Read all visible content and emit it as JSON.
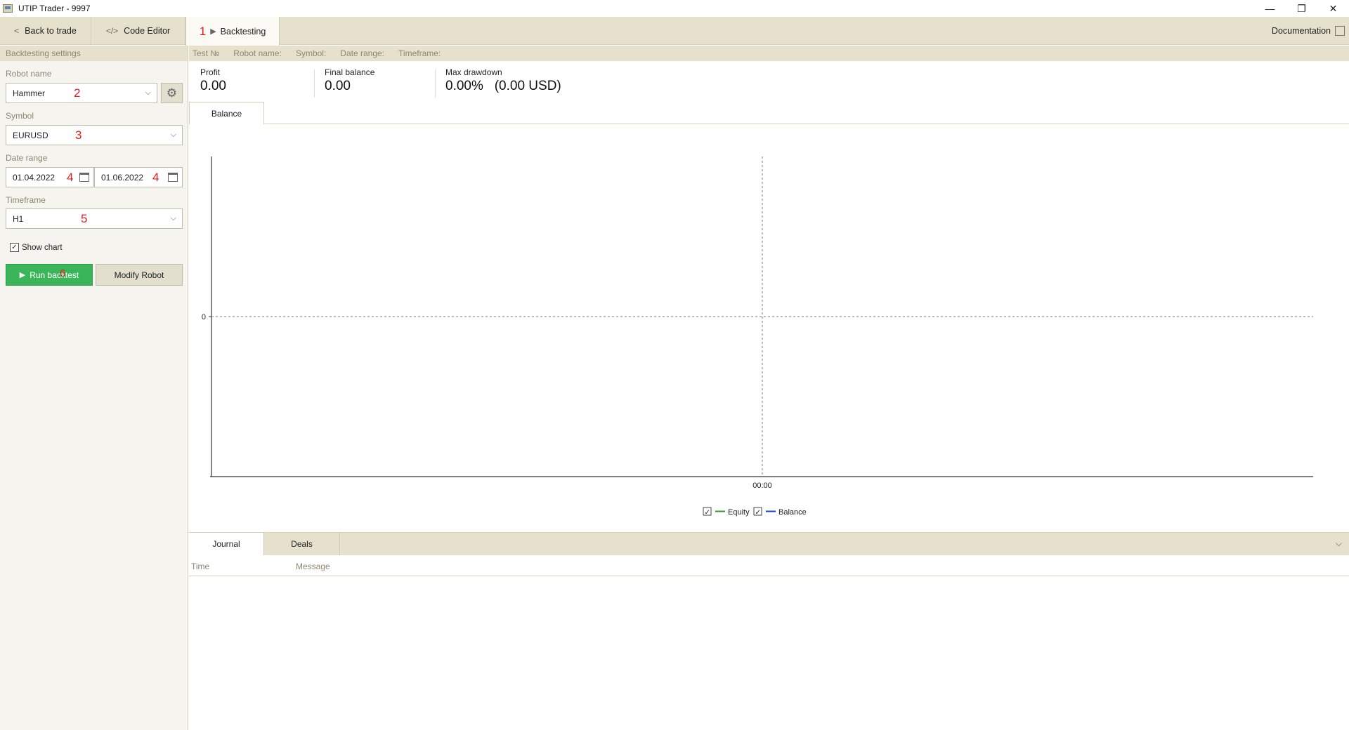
{
  "window": {
    "title": "UTIP Trader - 9997"
  },
  "tabs": {
    "back": "Back to trade",
    "code_editor": "Code Editor",
    "code_icon": "</>",
    "backtesting": "Backtesting",
    "backtesting_marker": "1",
    "documentation": "Documentation"
  },
  "settings": {
    "header": "Backtesting settings",
    "robot_label": "Robot name",
    "robot_value": "Hammer",
    "robot_marker": "2",
    "symbol_label": "Symbol",
    "symbol_value": "EURUSD",
    "symbol_marker": "3",
    "date_label": "Date range",
    "date_from": "01.04.2022",
    "date_to": "01.06.2022",
    "date_marker": "4",
    "timeframe_label": "Timeframe",
    "timeframe_value": "H1",
    "timeframe_marker": "5",
    "show_chart_label": "Show chart",
    "show_chart_checked": true,
    "run_label": "Run backtest",
    "run_marker": "6",
    "modify_label": "Modify Robot"
  },
  "info": {
    "test_no": "Test №",
    "robot_name": "Robot name:",
    "symbol": "Symbol:",
    "date_range": "Date range:",
    "timeframe": "Timeframe:"
  },
  "stats": {
    "profit_label": "Profit",
    "profit_value": "0.00",
    "final_label": "Final balance",
    "final_value": "0.00",
    "drawdown_label": "Max drawdown",
    "drawdown_value": "0.00%   (0.00 USD)"
  },
  "chart_tab": "Balance",
  "chart_data": {
    "type": "line",
    "x": [
      "00:00"
    ],
    "y_ticks": [
      0
    ],
    "series": [
      {
        "name": "Equity",
        "color": "#2e9a2e",
        "checked": true,
        "values": []
      },
      {
        "name": "Balance",
        "color": "#2040d0",
        "checked": true,
        "values": []
      }
    ],
    "grid": true,
    "legend": "bottom-center"
  },
  "bottom": {
    "journal": "Journal",
    "deals": "Deals",
    "col_time": "Time",
    "col_message": "Message"
  },
  "colors": {
    "accent_green": "#3bb55a",
    "panel": "#e5e1cc",
    "marker_red": "#e02020"
  }
}
